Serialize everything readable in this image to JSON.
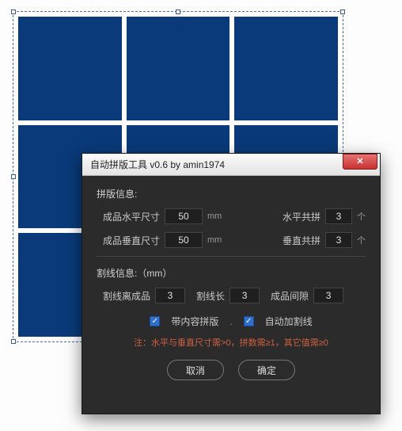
{
  "dialog": {
    "title": "自动拼版工具 v0.6   by amin1974",
    "section1_title": "拼版信息:",
    "hsize_label": "成品水平尺寸",
    "hsize_value": "50",
    "vsize_label": "成品垂直尺寸",
    "vsize_value": "50",
    "mm": "mm",
    "hcount_label": "水平共拼",
    "hcount_value": "3",
    "vcount_label": "垂直共拼",
    "vcount_value": "3",
    "count_unit": "个",
    "section2_title": "割线信息:（mm）",
    "cut_offset_label": "割线离成品",
    "cut_offset_value": "3",
    "cut_len_label": "割线长",
    "cut_len_value": "3",
    "gap_label": "成品间隙",
    "gap_value": "3",
    "chk1_label": "带内容拼版",
    "chk2_label": "自动加割线",
    "note": "注：水平与垂直尺寸需>0，拼数需≥1，其它值需≥0",
    "cancel": "取消",
    "ok": "确定"
  }
}
